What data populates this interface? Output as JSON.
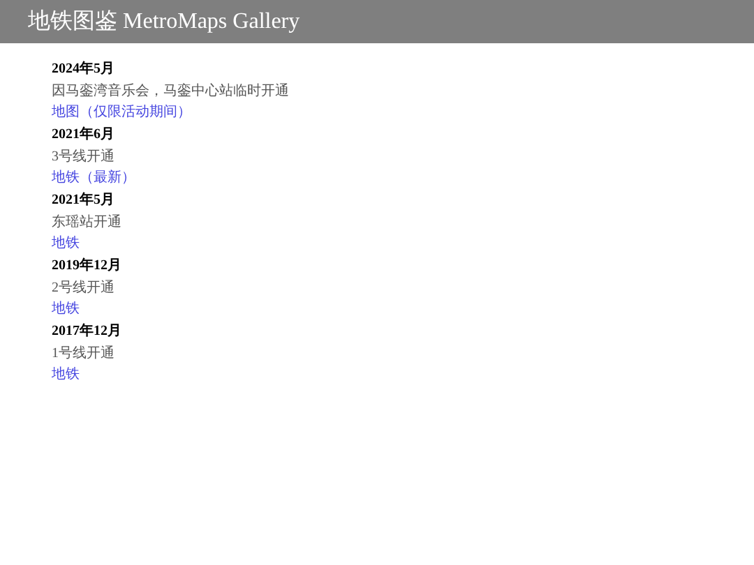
{
  "header": {
    "title": "地铁图鉴 MetroMaps Gallery"
  },
  "entries": [
    {
      "date": "2024年5月",
      "description": "因马銮湾音乐会，马銮中心站临时开通",
      "link": "地图（仅限活动期间）"
    },
    {
      "date": "2021年6月",
      "description": "3号线开通",
      "link": "地铁（最新）"
    },
    {
      "date": "2021年5月",
      "description": "东瑶站开通",
      "link": "地铁"
    },
    {
      "date": "2019年12月",
      "description": "2号线开通",
      "link": "地铁"
    },
    {
      "date": "2017年12月",
      "description": "1号线开通",
      "link": "地铁"
    }
  ]
}
